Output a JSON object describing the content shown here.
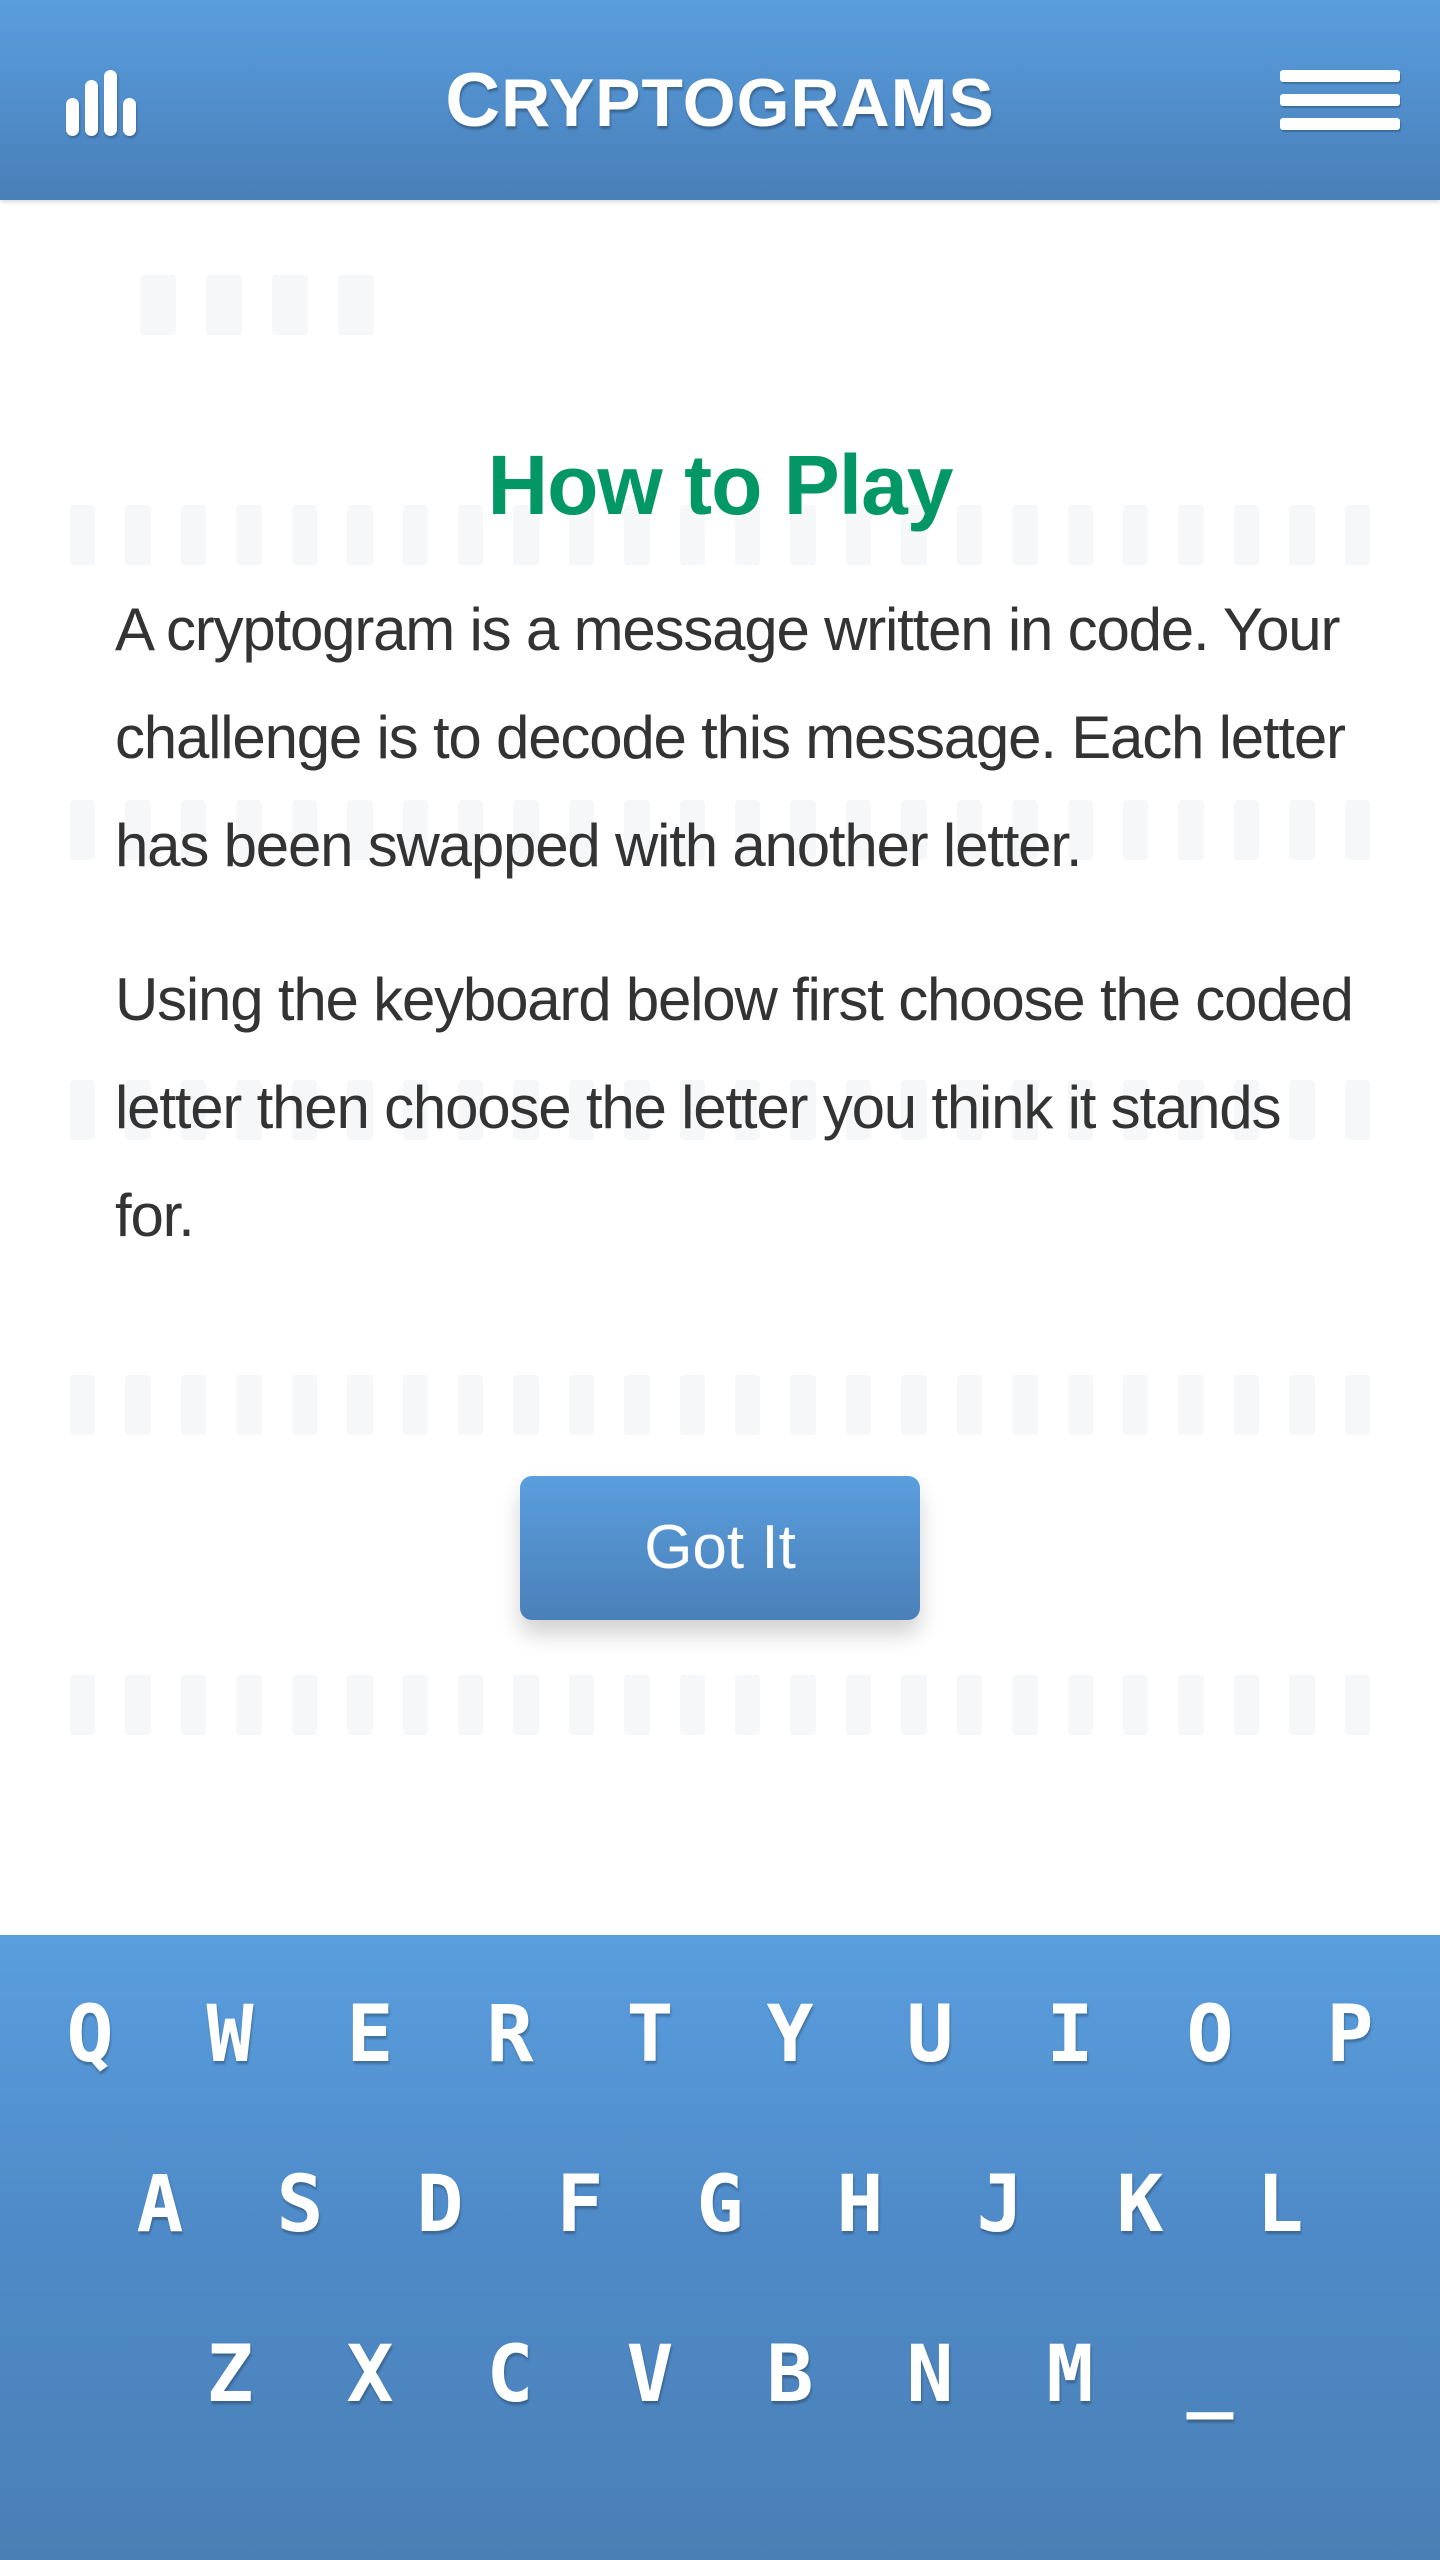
{
  "header": {
    "title_first": "C",
    "title_rest": "RYPTOGRAMS",
    "stats_icon": "bar-chart-icon",
    "menu_icon": "hamburger-menu-icon",
    "accent_color": "#5a9ede"
  },
  "how_to_play": {
    "title": "How to Play",
    "title_color": "#029765",
    "paragraphs": [
      "A cryptogram is a message written in code. Your challenge is to decode this message. Each letter has been swapped with another letter.",
      "Using the keyboard below first choose the coded letter then choose the letter you think it stands for."
    ],
    "button_label": "Got It"
  },
  "keyboard": {
    "rows": [
      [
        "Q",
        "W",
        "E",
        "R",
        "T",
        "Y",
        "U",
        "I",
        "O",
        "P"
      ],
      [
        "A",
        "S",
        "D",
        "F",
        "G",
        "H",
        "J",
        "K",
        "L"
      ],
      [
        "Z",
        "X",
        "C",
        "V",
        "B",
        "N",
        "M",
        "_"
      ]
    ]
  }
}
